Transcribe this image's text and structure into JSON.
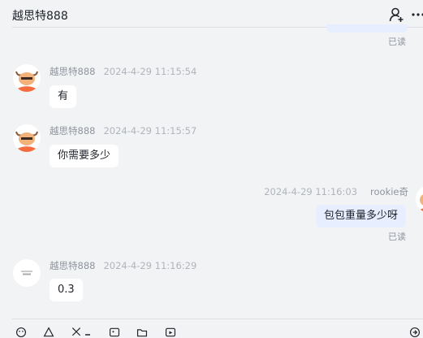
{
  "header": {
    "title": "越思特888"
  },
  "messages": [
    {
      "sender": "越思特888",
      "time": "2024-4-29 11:15:54",
      "text": "有"
    },
    {
      "sender": "越思特888",
      "time": "2024-4-29 11:15:57",
      "text": "你需要多少"
    },
    {
      "sender": "rookie奇",
      "time": "2024-4-29 11:16:03",
      "text": "包包重量多少呀",
      "status": "已读"
    },
    {
      "sender": "越思特888",
      "time": "2024-4-29 11:16:29",
      "text": "0.3"
    }
  ],
  "top_status": "已读",
  "colors": {
    "background": "#f2f3f5",
    "my_bubble": "#e6eeff",
    "their_bubble": "#ffffff",
    "muted_text": "#8f959e"
  },
  "icons": {
    "header": [
      "add-user-icon",
      "more-icon"
    ],
    "toolbar": [
      "emoji-icon",
      "shape-icon",
      "scissors-icon",
      "image-icon",
      "folder-icon",
      "video-icon",
      "send-icon"
    ]
  }
}
